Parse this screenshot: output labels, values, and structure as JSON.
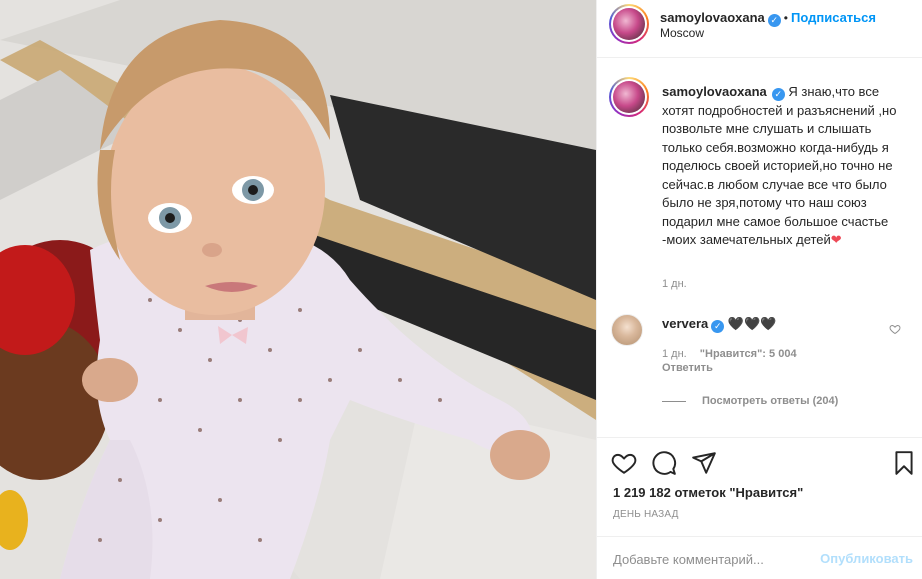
{
  "post": {
    "image_alt": "Девочка в светлой пижаме сидит на мраморном полу",
    "author": {
      "username": "samoylovaoxana",
      "verified": true,
      "follow_label": "Подписаться",
      "location": "Moscow"
    },
    "caption": {
      "username": "samoylovaoxana",
      "text": "Я знаю,что все хотят подробностей и разъяснений ,но позвольте мне слушать и слышать только себя.возможно когда-нибудь я поделюсь своей историей,но точно не сейчас.в любом случае все что было было не зря,потому что наш союз подарил мне самое большое счастье -моих замечательных детей",
      "emoji": "❤",
      "time": "1 дн."
    },
    "comments": [
      {
        "username": "ververa",
        "verified": true,
        "text": "🖤🖤🖤",
        "time": "1 дн.",
        "likes_label": "\"Нравится\": 5 004",
        "reply_label": "Ответить",
        "view_replies_label": "Посмотреть ответы (204)"
      }
    ],
    "likes_text": "1 219 182 отметок \"Нравится\"",
    "date_text": "ДЕНЬ НАЗАД",
    "comment_placeholder": "Добавьте комментарий...",
    "publish_label": "Опубликовать"
  },
  "icons": {
    "like": "heart-outline-icon",
    "comment": "comment-bubble-icon",
    "share": "paper-plane-icon",
    "save": "bookmark-icon"
  },
  "colors": {
    "link_blue": "#0095f6",
    "verified_blue": "#3897f0",
    "publish_disabled": "#b2dffc",
    "meta_gray": "#8e8e8e",
    "heart_red": "#ed4956"
  }
}
